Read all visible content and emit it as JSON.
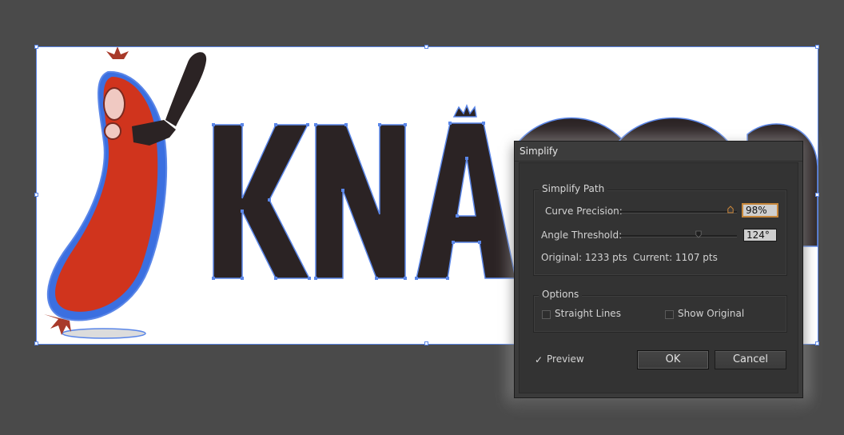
{
  "dialog": {
    "title": "Simplify",
    "simplify_path": {
      "group_label": "Simplify Path",
      "curve_precision": {
        "label": "Curve Precision:",
        "value": "98%",
        "level": 0.98
      },
      "angle_threshold": {
        "label": "Angle Threshold:",
        "value": "124°",
        "level": 0.69
      },
      "original_label": "Original: 1233 pts",
      "current_label": "Current: 1107 pts"
    },
    "options": {
      "group_label": "Options",
      "straight_lines": {
        "label": "Straight Lines",
        "checked": false
      },
      "show_original": {
        "label": "Show Original",
        "checked": false
      }
    },
    "preview": {
      "label": "Preview",
      "checked": true
    },
    "ok_label": "OK",
    "cancel_label": "Cancel"
  },
  "canvas": {
    "artwork_text": "KNA",
    "colors": {
      "pasteboard": "#4a4a4a",
      "artboard": "#ffffff",
      "selection": "#5a86e8",
      "letter_fill": "#2b2324",
      "sausage_red": "#d0341d",
      "sausage_highlight": "#f0c9c2"
    }
  }
}
